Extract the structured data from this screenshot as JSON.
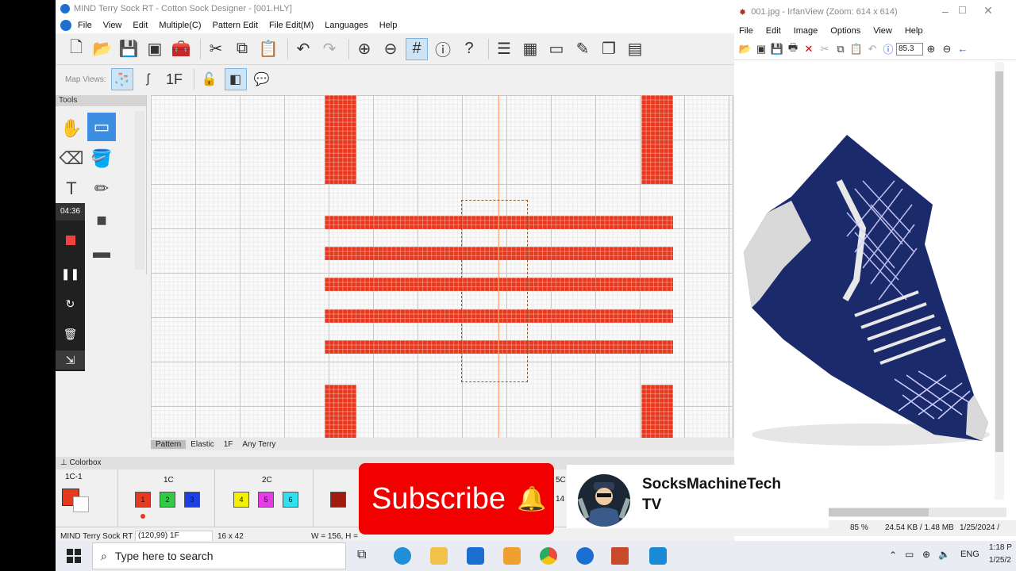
{
  "app": {
    "title": "MIND Terry Sock RT - Cotton Sock Designer - [001.HLY]",
    "menu": [
      "File",
      "View",
      "Edit",
      "Multiple(C)",
      "Pattern Edit",
      "File Edit(M)",
      "Languages",
      "Help"
    ],
    "map_views_label": "Map Views:",
    "map_view_1f": "1F",
    "tools_label": "Tools",
    "record_time": "04:36",
    "pattern_tabs": [
      "Pattern",
      "Elastic",
      "1F",
      "Any Terry"
    ],
    "colorbox_label": "Colorbox",
    "colorbox": {
      "current_label": "1C-1",
      "groups": [
        {
          "label": "1C",
          "swatches": [
            {
              "num": "1",
              "color": "#e8381e"
            },
            {
              "num": "2",
              "color": "#2ecc40"
            },
            {
              "num": "3",
              "color": "#1a3ee8"
            }
          ]
        },
        {
          "label": "2C",
          "swatches": [
            {
              "num": "4",
              "color": "#f2f200"
            },
            {
              "num": "5",
              "color": "#e83ae8"
            },
            {
              "num": "6",
              "color": "#2ee0f0"
            }
          ]
        }
      ],
      "partial_label": "5C",
      "partial_num": "14"
    },
    "status": {
      "app_name": "MIND Terry Sock RT",
      "coords": "(120,99) 1F",
      "size": "16 x 42",
      "dims": "W = 156, H ="
    }
  },
  "irfanview": {
    "title": "001.jpg - IrfanView (Zoom: 614 x 614)",
    "menu": [
      "File",
      "Edit",
      "Image",
      "Options",
      "View",
      "Help"
    ],
    "zoom_value": "85.3",
    "status": {
      "zoom": "85 %",
      "filesize": "24.54 KB / 1.48 MB",
      "date": "1/25/2024 /"
    }
  },
  "overlay": {
    "subscribe": "Subscribe",
    "channel_line1": "SocksMachineTech",
    "channel_line2": "TV"
  },
  "taskbar": {
    "search_placeholder": "Type here to search",
    "language": "ENG",
    "time": "1:18 P",
    "date": "1/25/2"
  },
  "colors": {
    "pattern_red": "#e8381e",
    "subscribe_red": "#f20000",
    "sock_navy": "#1b2a6b"
  }
}
